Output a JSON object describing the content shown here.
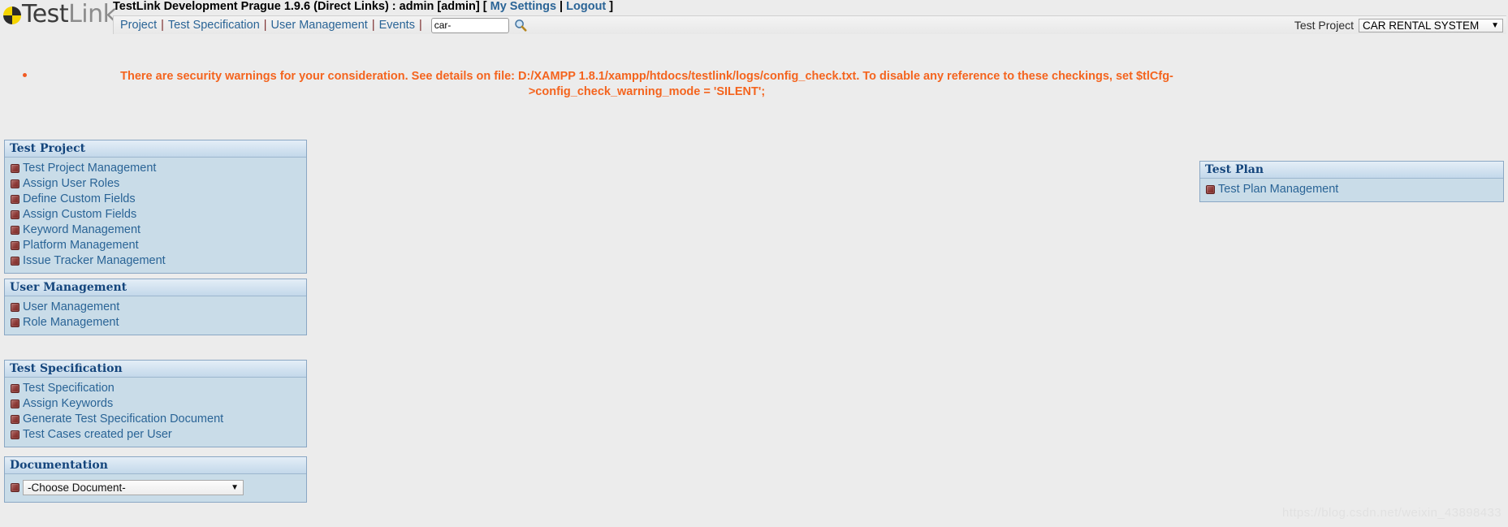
{
  "brand": {
    "logo_text_1": "Test",
    "logo_text_2": "Link",
    "logo_icon": "testlink-pie-logo"
  },
  "header": {
    "title_prefix": "TestLink Development Prague 1.9.6 (Direct Links) : admin [admin] [ ",
    "my_settings_label": "My Settings",
    "title_sep": " | ",
    "logout_label": "Logout",
    "title_suffix": " ]"
  },
  "nav": {
    "items": [
      {
        "label": "Project"
      },
      {
        "label": "Test Specification"
      },
      {
        "label": "User Management"
      },
      {
        "label": "Events"
      }
    ],
    "separator": "|",
    "search": {
      "value": "car-",
      "placeholder": "",
      "icon": "search-icon"
    },
    "project_selector": {
      "label": "Test Project",
      "selected": "CAR RENTAL SYSTEM",
      "caret": "▼"
    }
  },
  "warning": {
    "bullet": "•",
    "text": "There are security warnings for your consideration. See details on file: D:/XAMPP 1.8.1/xampp/htdocs/testlink/logs/config_check.txt. To disable any reference to these checkings, set $tlCfg->config_check_warning_mode = 'SILENT';",
    "color": "#f4641e"
  },
  "panels": {
    "test_project": {
      "title": "Test Project",
      "items": [
        {
          "label": "Test Project Management"
        },
        {
          "label": "Assign User Roles"
        },
        {
          "label": "Define Custom Fields"
        },
        {
          "label": "Assign Custom Fields"
        },
        {
          "label": "Keyword Management"
        },
        {
          "label": "Platform Management"
        },
        {
          "label": "Issue Tracker Management"
        }
      ]
    },
    "user_management": {
      "title": "User Management",
      "items": [
        {
          "label": "User Management"
        },
        {
          "label": "Role Management"
        }
      ]
    },
    "test_specification": {
      "title": "Test Specification",
      "items": [
        {
          "label": "Test Specification"
        },
        {
          "label": "Assign Keywords"
        },
        {
          "label": "Generate Test Specification Document"
        },
        {
          "label": "Test Cases created per User"
        }
      ]
    },
    "documentation": {
      "title": "Documentation",
      "select": {
        "selected": "-Choose Document-",
        "caret": "▼"
      }
    },
    "test_plan": {
      "title": "Test Plan",
      "items": [
        {
          "label": "Test Plan Management"
        }
      ]
    }
  },
  "watermark": {
    "text": "https://blog.csdn.net/weixin_43898433"
  }
}
